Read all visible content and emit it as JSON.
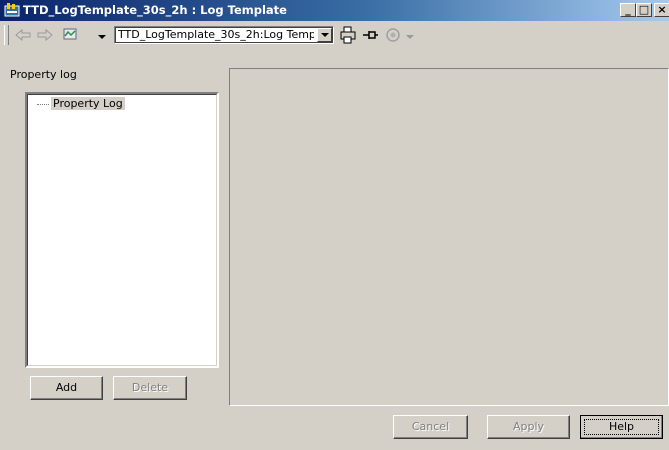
{
  "window": {
    "title": "TTD_LogTemplate_30s_2h : Log Template",
    "minimize_glyph": "_",
    "maximize_glyph": "□",
    "close_glyph": "×"
  },
  "toolbar": {
    "back_icon": "back-arrow-icon",
    "forward_icon": "forward-arrow-icon",
    "view_icon": "object-view-icon",
    "combo_value": "TTD_LogTemplate_30s_2h:Log Temp",
    "print_icon": "print-icon",
    "pin_icon": "pin-icon",
    "disabled_icon": "view-eye-icon"
  },
  "left": {
    "section_label": "Property log",
    "tree_item": "Property Log",
    "add_label": "Add",
    "delete_label": "Delete"
  },
  "footer": {
    "cancel_label": "Cancel",
    "apply_label": "Apply",
    "help_label": "Help"
  }
}
